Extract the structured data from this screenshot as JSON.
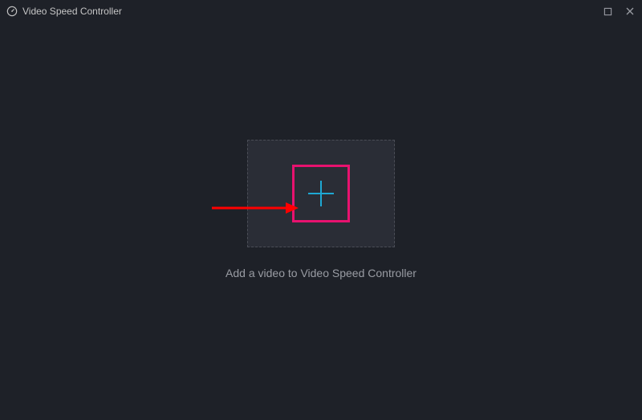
{
  "titlebar": {
    "app_title": "Video Speed Controller"
  },
  "main": {
    "instruction_text": "Add a video to Video Speed Controller"
  },
  "icons": {
    "app": "speed-gauge-icon",
    "maximize": "maximize-icon",
    "close": "close-icon",
    "plus": "plus-icon"
  },
  "colors": {
    "background": "#1e2128",
    "dropzone_bg": "#2a2d36",
    "border_dashed": "#4a4d56",
    "highlight": "#e8126f",
    "plus": "#1ea8d4",
    "text_muted": "#999ca3",
    "arrow": "#ff0000"
  }
}
